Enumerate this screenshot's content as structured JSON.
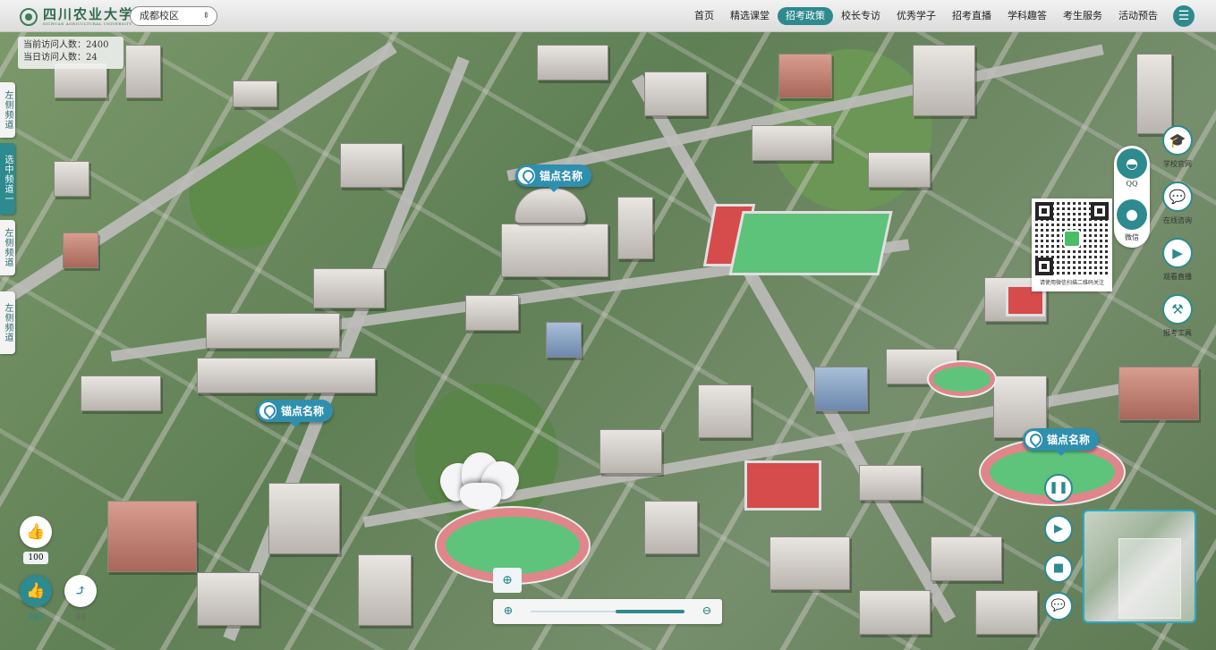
{
  "header": {
    "logo_cn": "四川农业大学",
    "logo_en": "SICHUAN AGRICULTURAL UNIVERSITY",
    "campus_select": "成都校区",
    "nav": [
      "首页",
      "精选课堂",
      "招考政策",
      "校长专访",
      "优秀学子",
      "招考直播",
      "学科趣答",
      "考生服务",
      "活动预告"
    ],
    "active_nav": "招考政策"
  },
  "visitors": {
    "current_label": "当前访问人数：",
    "current_value": "2400",
    "today_label": "当日访问人数：",
    "today_value": "24"
  },
  "channels": [
    {
      "label": "左侧频道",
      "active": false
    },
    {
      "label": "选中频道一",
      "active": true
    },
    {
      "label": "左侧频道",
      "active": false
    },
    {
      "label": "左侧频道",
      "active": false
    }
  ],
  "markers": [
    "锚点名称",
    "锚点名称",
    "锚点名称"
  ],
  "contact": {
    "qq_label": "QQ",
    "wechat_label": "微信",
    "qr_caption": "请使用微信扫描二维码关注"
  },
  "side_buttons": [
    "学校官网",
    "在线咨询",
    "观看直播",
    "报考工具"
  ],
  "likes": {
    "like1_count": "100",
    "like2_count": "101",
    "share_count": "99"
  },
  "zoom": {
    "level": 0.7
  },
  "colors": {
    "accent": "#2d8a8e",
    "marker": "#2f8fae"
  }
}
